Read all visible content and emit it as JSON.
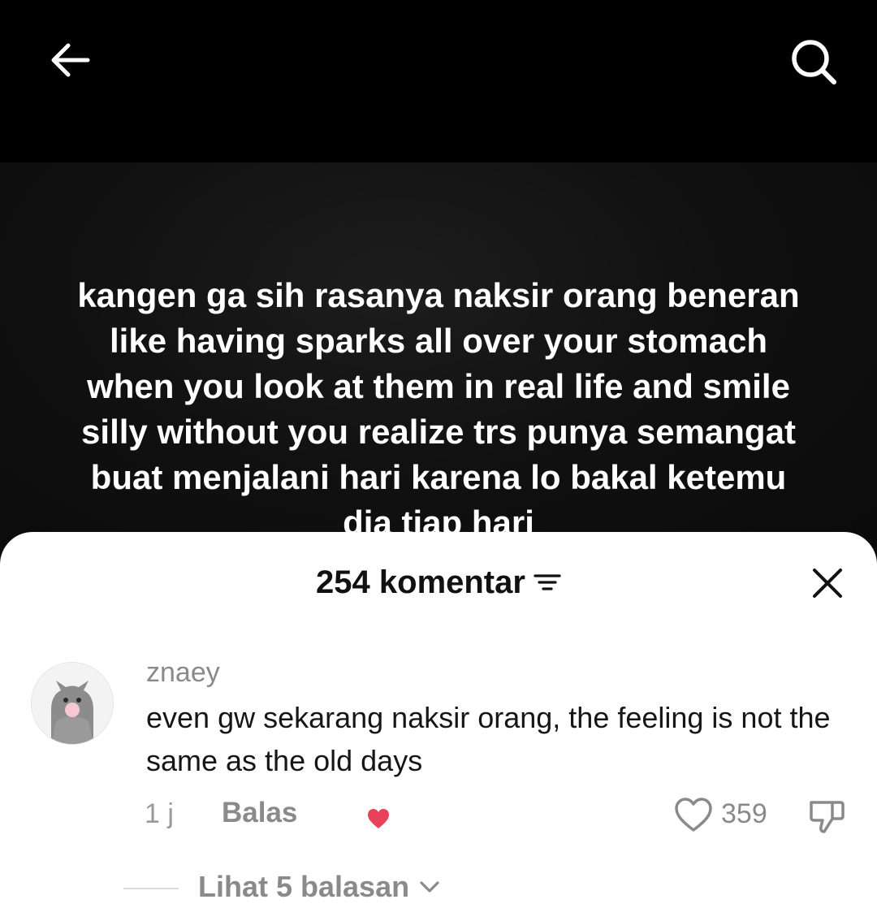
{
  "topbar": {
    "back_icon": "arrow-left-icon",
    "search_icon": "search-icon"
  },
  "video": {
    "caption": "kangen ga sih rasanya naksir orang beneran like having sparks all over your stomach when you look at them in real life and smile silly without you realize trs punya semangat buat menjalani hari karena lo bakal ketemu dia tiap hari"
  },
  "comments_sheet": {
    "title": "254 komentar",
    "sort_icon": "sort-lines-icon",
    "close_icon": "close-icon",
    "comment": {
      "username": "znaey",
      "text": "even gw sekarang naksir orang, the feeling is not the same as the old days",
      "time": "1 j",
      "reply_label": "Balas",
      "creator_liked_icon": "heart-filled-icon",
      "like_count": "359",
      "like_icon": "heart-outline-icon",
      "dislike_icon": "thumbs-down-icon"
    },
    "view_replies_label": "Lihat 5 balasan",
    "view_replies_icon": "chevron-down-icon"
  },
  "colors": {
    "background_dark": "#000000",
    "sheet": "#ffffff",
    "accent_heart": "#e8425a",
    "muted_text": "#8a8a8a"
  }
}
